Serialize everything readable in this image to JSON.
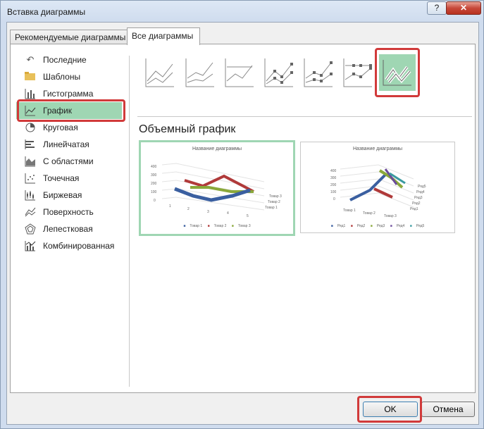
{
  "window": {
    "title": "Вставка диаграммы",
    "help_label": "?",
    "close_label": "✕"
  },
  "tabs": [
    {
      "label": "Рекомендуемые диаграммы",
      "active": false
    },
    {
      "label": "Все диаграммы",
      "active": true
    }
  ],
  "sidebar": {
    "items": [
      {
        "label": "Последние",
        "icon": "undo-arrow-icon"
      },
      {
        "label": "Шаблоны",
        "icon": "folder-icon"
      },
      {
        "label": "Гистограмма",
        "icon": "column-chart-icon"
      },
      {
        "label": "График",
        "icon": "line-chart-icon",
        "selected": true
      },
      {
        "label": "Круговая",
        "icon": "pie-chart-icon"
      },
      {
        "label": "Линейчатая",
        "icon": "bar-chart-icon"
      },
      {
        "label": "С областями",
        "icon": "area-chart-icon"
      },
      {
        "label": "Точечная",
        "icon": "scatter-chart-icon"
      },
      {
        "label": "Биржевая",
        "icon": "stock-chart-icon"
      },
      {
        "label": "Поверхность",
        "icon": "surface-chart-icon"
      },
      {
        "label": "Лепестковая",
        "icon": "radar-chart-icon"
      },
      {
        "label": "Комбинированная",
        "icon": "combo-chart-icon"
      }
    ]
  },
  "subtypes": {
    "count": 7,
    "selected_index": 6
  },
  "main": {
    "section_title": "Объемный график",
    "preview1": {
      "title": "Название диаграммы",
      "y_ticks": [
        "400",
        "300",
        "200",
        "100",
        "0"
      ],
      "x_ticks": [
        "1",
        "2",
        "3",
        "4",
        "5"
      ],
      "depth_labels": [
        "Товар 3",
        "Товар 2",
        "Товар 1"
      ],
      "legend": [
        "Товар 1",
        "Товар 2",
        "Товар 3"
      ]
    },
    "preview2": {
      "title": "Название диаграммы",
      "y_ticks": [
        "400",
        "300",
        "200",
        "100",
        "0"
      ],
      "x_ticks": [
        "Товар 1",
        "Товар 2",
        "Товар 3"
      ],
      "depth_labels": [
        "Ряд5",
        "Ряд4",
        "Ряд3",
        "Ряд2",
        "Ряд1"
      ],
      "legend": [
        "Ряд1",
        "Ряд2",
        "Ряд3",
        "Ряд4",
        "Ряд5"
      ]
    }
  },
  "colors": {
    "selection": "#9fd6b3",
    "highlight": "#d13a3a",
    "series_blue": "#3a5fa0",
    "series_red": "#b03a3a",
    "series_green": "#8aa83a"
  },
  "footer": {
    "ok_label": "OK",
    "cancel_label": "Отмена"
  }
}
